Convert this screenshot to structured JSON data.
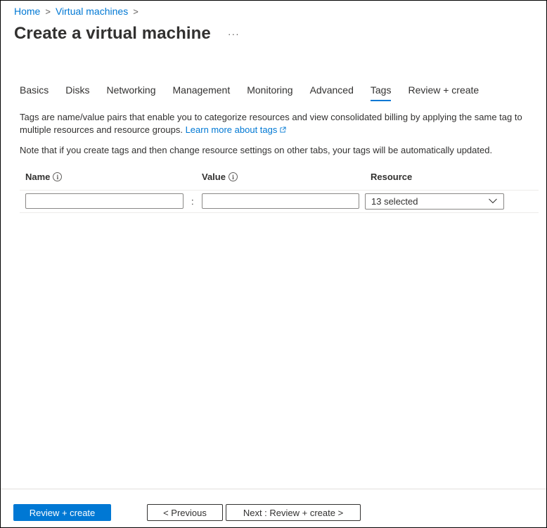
{
  "breadcrumb": [
    {
      "label": "Home"
    },
    {
      "label": "Virtual machines"
    }
  ],
  "breadcrumb_separator": ">",
  "page": {
    "title": "Create a virtual machine",
    "more_label": "···"
  },
  "tabs": [
    {
      "label": "Basics",
      "active": false
    },
    {
      "label": "Disks",
      "active": false
    },
    {
      "label": "Networking",
      "active": false
    },
    {
      "label": "Management",
      "active": false
    },
    {
      "label": "Monitoring",
      "active": false
    },
    {
      "label": "Advanced",
      "active": false
    },
    {
      "label": "Tags",
      "active": true
    },
    {
      "label": "Review + create",
      "active": false
    }
  ],
  "description": {
    "text": "Tags are name/value pairs that enable you to categorize resources and view consolidated billing by applying the same tag to multiple resources and resource groups.",
    "link_label": "Learn more about tags",
    "link_icon": "external-link-icon"
  },
  "note": "Note that if you create tags and then change resource settings on other tabs, your tags will be automatically updated.",
  "grid": {
    "columns": {
      "name": "Name",
      "value": "Value",
      "resource": "Resource"
    },
    "info_glyph": "i",
    "row": {
      "name_value": "",
      "separator": ":",
      "value_value": "",
      "resource_selected": "13 selected"
    }
  },
  "footer": {
    "primary_label": "Review + create",
    "previous_label": "< Previous",
    "next_label": "Next : Review + create >"
  },
  "colors": {
    "accent": "#0078d4",
    "text": "#323130",
    "border": "#8a8886"
  }
}
